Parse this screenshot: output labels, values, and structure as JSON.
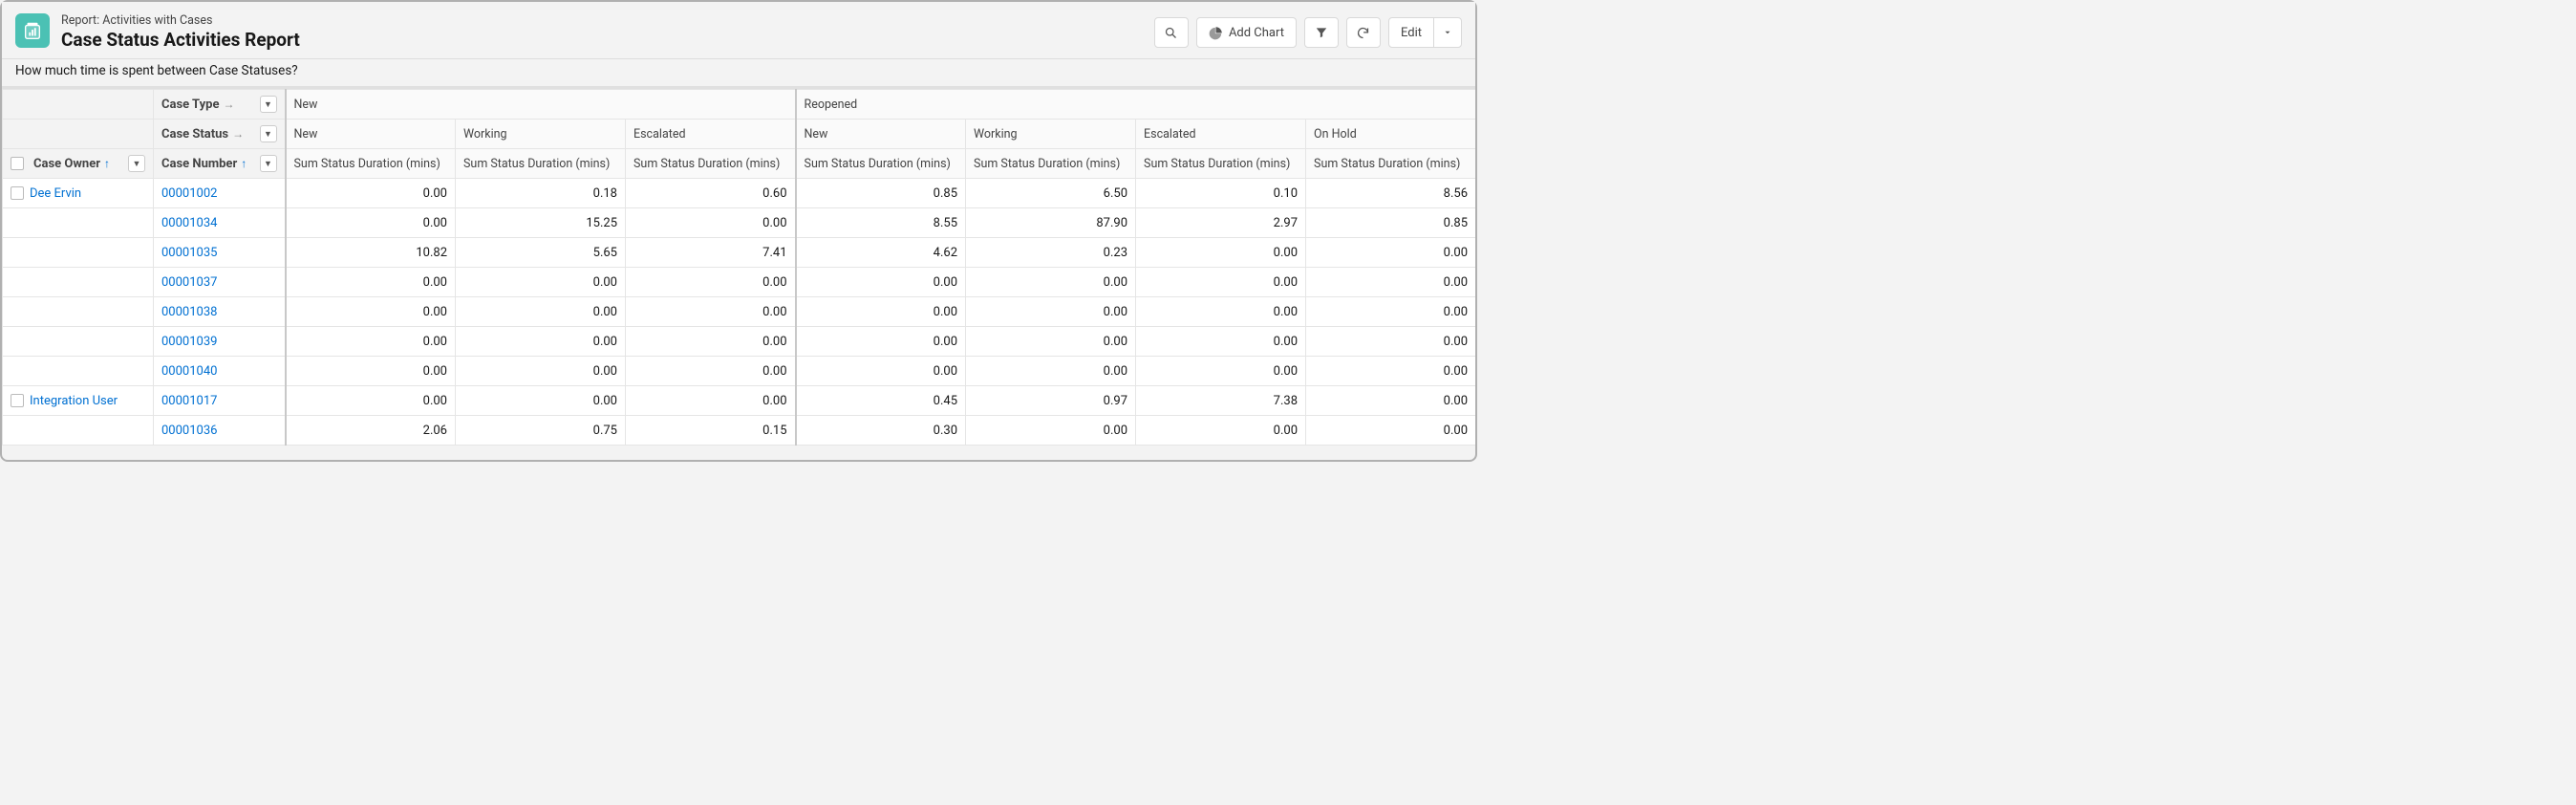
{
  "header": {
    "context": "Report: Activities with Cases",
    "title": "Case Status Activities Report",
    "subtitle": "How much time is spent between Case Statuses?"
  },
  "toolbar": {
    "add_chart": "Add Chart",
    "edit": "Edit"
  },
  "dims": {
    "case_type": "Case Type",
    "case_status": "Case Status",
    "case_owner": "Case Owner",
    "case_number": "Case Number"
  },
  "groups": {
    "type_new": "New",
    "type_reopened": "Reopened",
    "status_new": "New",
    "status_working": "Working",
    "status_escalated": "Escalated",
    "status_onhold": "On Hold"
  },
  "agg_label": "Sum Status Duration (mins)",
  "rows": [
    {
      "owner": "Dee Ervin",
      "case": "00001002",
      "v": [
        "0.00",
        "0.18",
        "0.60",
        "0.85",
        "6.50",
        "0.10",
        "8.56"
      ]
    },
    {
      "owner": "",
      "case": "00001034",
      "v": [
        "0.00",
        "15.25",
        "0.00",
        "8.55",
        "87.90",
        "2.97",
        "0.85"
      ]
    },
    {
      "owner": "",
      "case": "00001035",
      "v": [
        "10.82",
        "5.65",
        "7.41",
        "4.62",
        "0.23",
        "0.00",
        "0.00"
      ]
    },
    {
      "owner": "",
      "case": "00001037",
      "v": [
        "0.00",
        "0.00",
        "0.00",
        "0.00",
        "0.00",
        "0.00",
        "0.00"
      ]
    },
    {
      "owner": "",
      "case": "00001038",
      "v": [
        "0.00",
        "0.00",
        "0.00",
        "0.00",
        "0.00",
        "0.00",
        "0.00"
      ]
    },
    {
      "owner": "",
      "case": "00001039",
      "v": [
        "0.00",
        "0.00",
        "0.00",
        "0.00",
        "0.00",
        "0.00",
        "0.00"
      ]
    },
    {
      "owner": "",
      "case": "00001040",
      "v": [
        "0.00",
        "0.00",
        "0.00",
        "0.00",
        "0.00",
        "0.00",
        "0.00"
      ]
    },
    {
      "owner": "Integration User",
      "case": "00001017",
      "v": [
        "0.00",
        "0.00",
        "0.00",
        "0.45",
        "0.97",
        "7.38",
        "0.00"
      ]
    },
    {
      "owner": "",
      "case": "00001036",
      "v": [
        "2.06",
        "0.75",
        "0.15",
        "0.30",
        "0.00",
        "0.00",
        "0.00"
      ]
    }
  ]
}
